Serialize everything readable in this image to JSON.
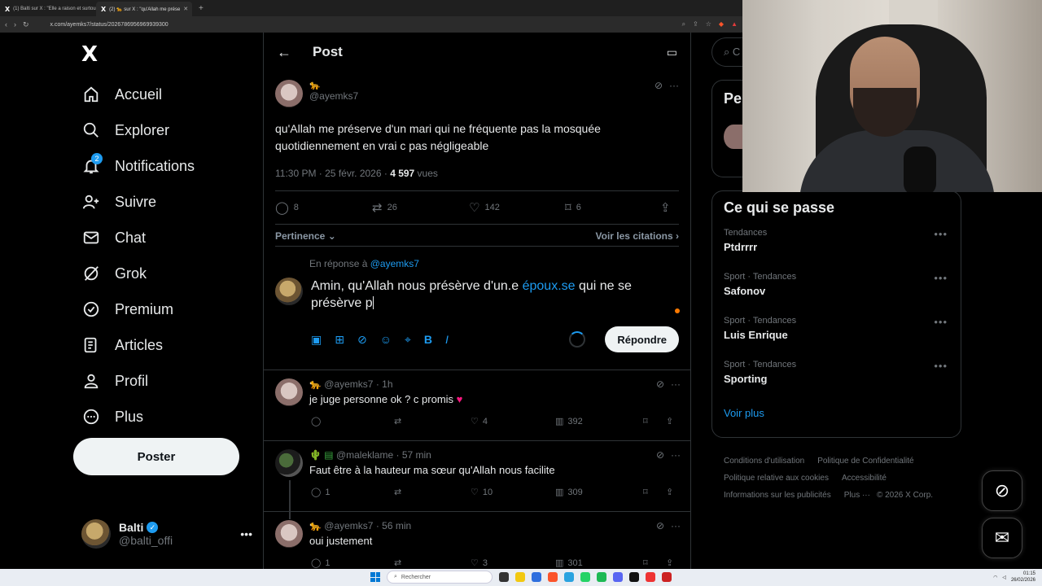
{
  "browser": {
    "tabs": [
      {
        "label": "(1) Balti sur X : \"Elle a raison et surtou",
        "active": false
      },
      {
        "label": "(2) 🐆 sur X : \"qu'Allah me prése",
        "active": true
      }
    ],
    "url": "x.com/ayemks7/status/2026786956969939300"
  },
  "logo": "X",
  "nav": {
    "items": [
      {
        "label": "Accueil",
        "icon": "home-icon"
      },
      {
        "label": "Explorer",
        "icon": "search-icon"
      },
      {
        "label": "Notifications",
        "icon": "bell-icon",
        "badge": "2"
      },
      {
        "label": "Suivre",
        "icon": "add-user-icon"
      },
      {
        "label": "Chat",
        "icon": "mail-icon"
      },
      {
        "label": "Grok",
        "icon": "grok-icon"
      },
      {
        "label": "Premium",
        "icon": "verified-icon"
      },
      {
        "label": "Articles",
        "icon": "article-icon"
      },
      {
        "label": "Profil",
        "icon": "user-icon"
      },
      {
        "label": "Plus",
        "icon": "more-circle-icon"
      }
    ],
    "post_button": "Poster"
  },
  "account": {
    "name": "Balti",
    "handle": "@balti_offi"
  },
  "header": {
    "title": "Post"
  },
  "post": {
    "handle": "@ayemks7",
    "text": "qu'Allah me préserve d'un mari qui ne fréquente pas la mosquée quotidiennement en vrai c pas négligeable",
    "time": "11:30 PM · 25 févr. 2026 · ",
    "views": "4 597",
    "views_label": " vues",
    "stats": {
      "replies": "8",
      "reposts": "26",
      "likes": "142",
      "bookmarks": "6"
    }
  },
  "sort": {
    "left": "Pertinence",
    "right": "Voir les citations"
  },
  "composer": {
    "reply_to_prefix": "En réponse à ",
    "reply_to_handle": "@ayemks7",
    "text_before": "Amin, qu'Allah nous présèrve d'un.e ",
    "text_link": "époux.se",
    "text_after": " qui ne se présèrve p",
    "reply_button": "Répondre"
  },
  "replies": [
    {
      "name": "",
      "handle": "@ayemks7",
      "time": "· 1h",
      "text": "je juge personne ok ? c promis",
      "replies": "",
      "likes": "4",
      "views": "392"
    },
    {
      "name": "@maleklame",
      "handle": "",
      "time": "· 57 min",
      "text": "Faut être à la hauteur ma sœur qu'Allah nous facilite",
      "replies": "1",
      "likes": "10",
      "views": "309"
    },
    {
      "name": "",
      "handle": "@ayemks7",
      "time": "· 56 min",
      "text": "oui justement",
      "replies": "1",
      "likes": "3",
      "views": "301"
    }
  ],
  "right": {
    "search_placeholder": "C",
    "pe_title": "Pe",
    "trends_title": "Ce qui se passe",
    "trends": [
      {
        "category": "Tendances",
        "name": "Ptdrrrr"
      },
      {
        "category": "Sport · Tendances",
        "name": "Safonov"
      },
      {
        "category": "Sport · Tendances",
        "name": "Luis Enrique"
      },
      {
        "category": "Sport · Tendances",
        "name": "Sporting"
      }
    ],
    "see_more": "Voir plus",
    "footer": [
      "Conditions d'utilisation",
      "Politique de Confidentialité",
      "Politique relative aux cookies",
      "Accessibilité",
      "Informations sur les publicités",
      "Plus ···",
      "© 2026 X Corp."
    ]
  },
  "taskbar": {
    "search": "Rechercher",
    "time": "01:15",
    "date": "26/02/2026"
  },
  "colors": {
    "accent": "#1d9bf0",
    "background": "#000000",
    "text": "#e7e9ea",
    "muted": "#71767b",
    "like": "#f91880"
  }
}
